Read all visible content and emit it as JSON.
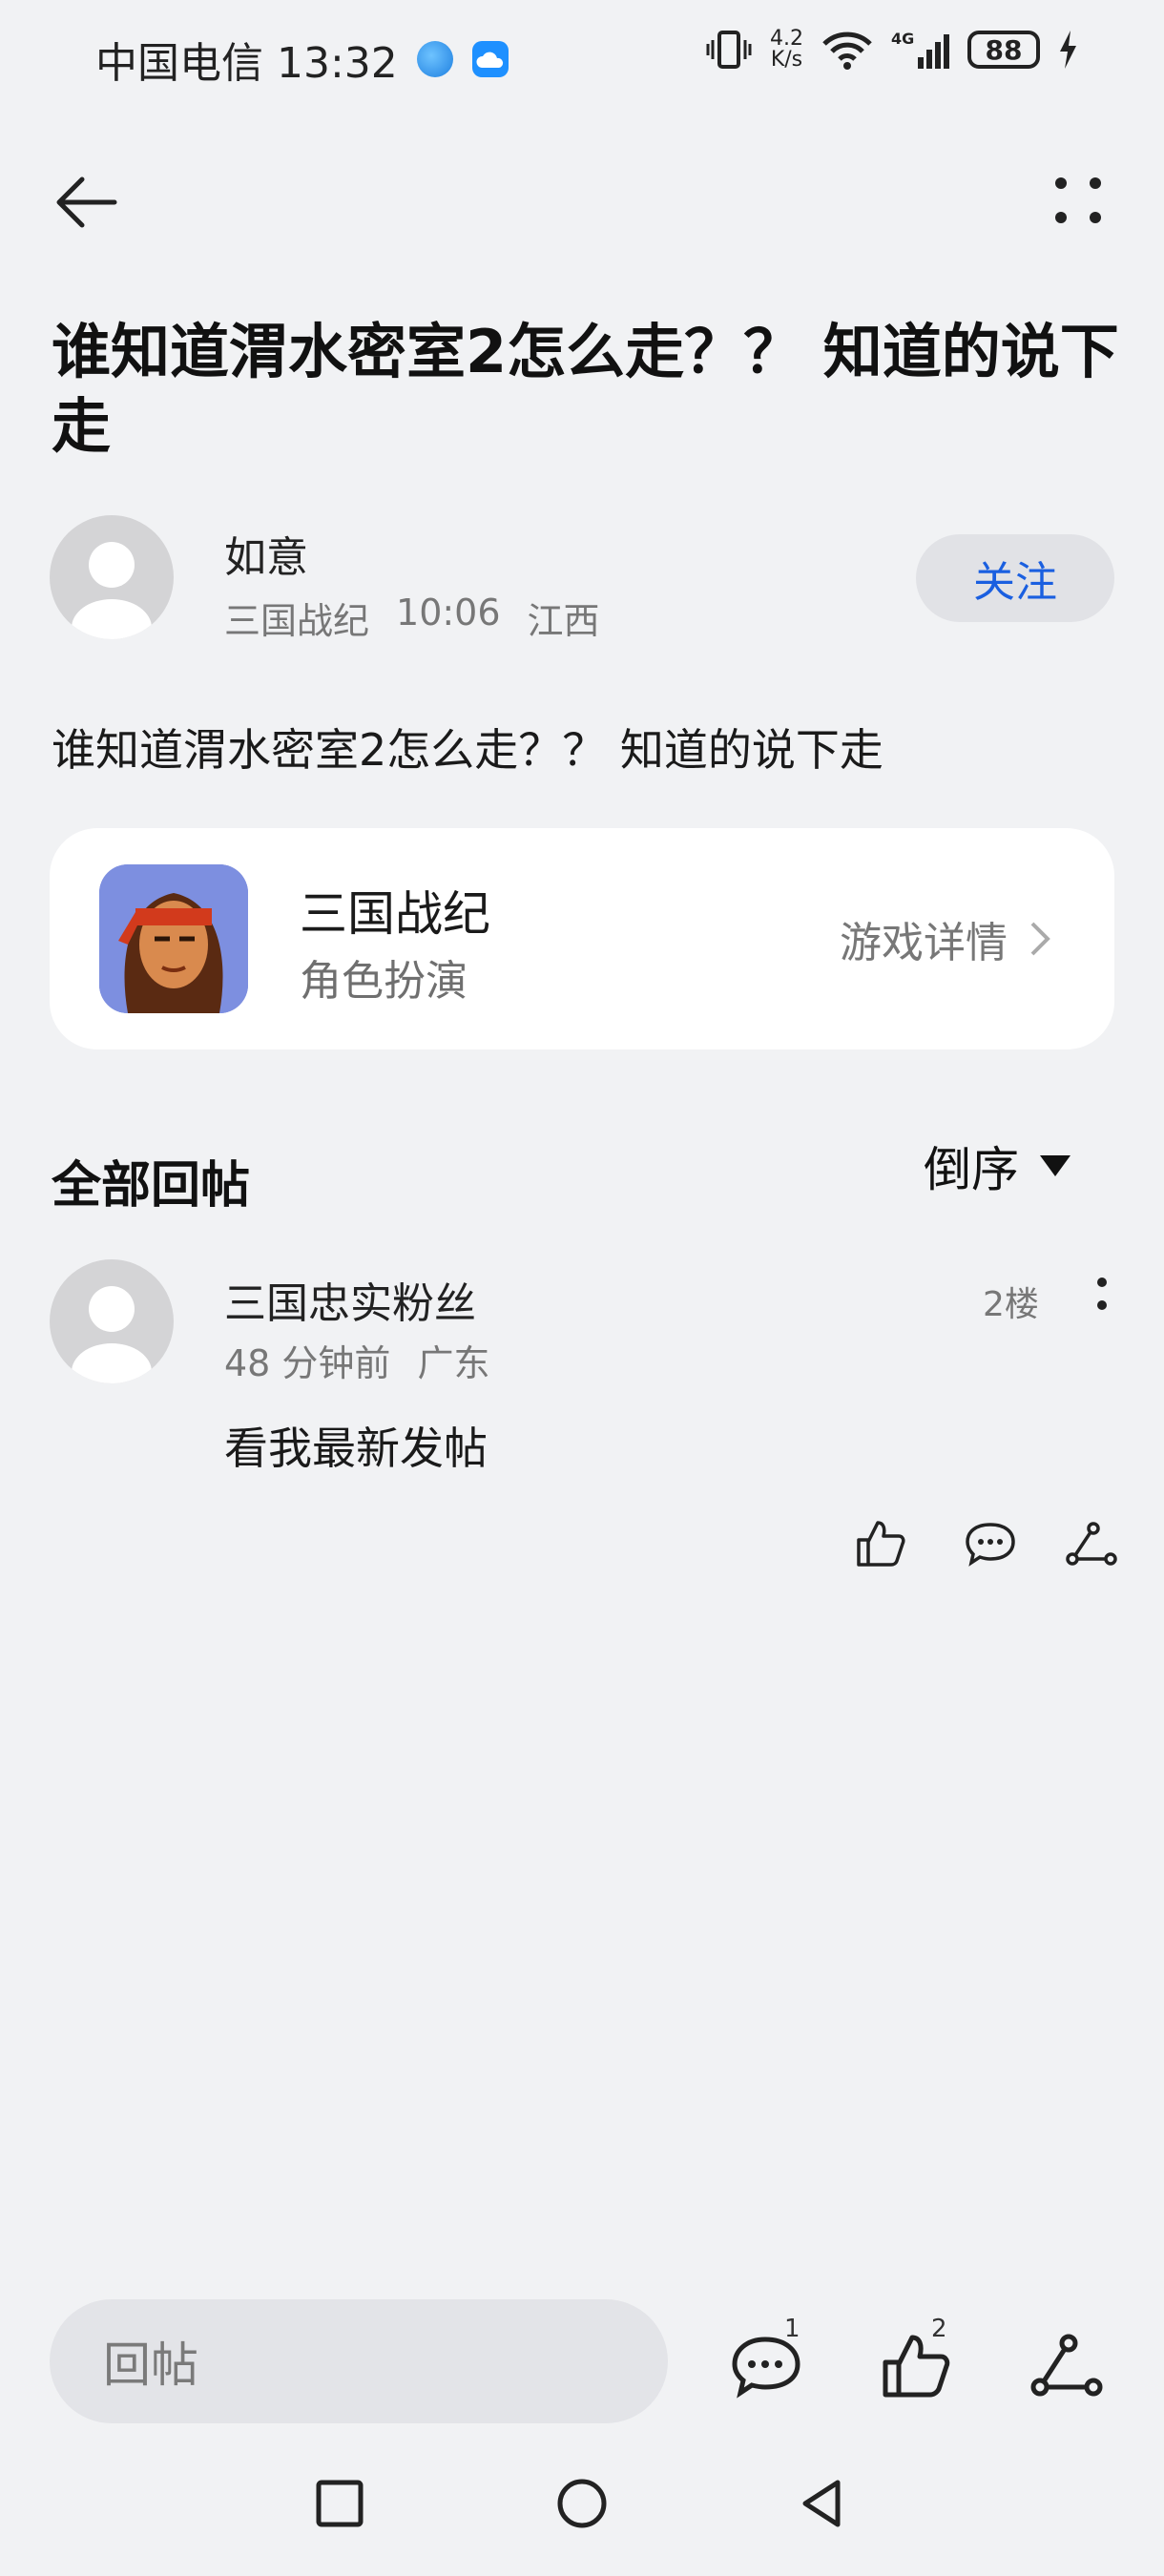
{
  "status_bar": {
    "carrier_time": "中国电信 13:32",
    "net_speed_value": "4.2",
    "net_speed_unit": "K/s",
    "network": "4G",
    "battery": "88"
  },
  "post": {
    "title": "谁知道渭水密室2怎么走？？ 知道的说下走",
    "author": "如意",
    "game_tag": "三国战纪",
    "time": "10:06",
    "location": "江西",
    "follow_label": "关注",
    "body": "谁知道渭水密室2怎么走？？ 知道的说下走"
  },
  "game_card": {
    "name": "三国战纪",
    "genre": "角色扮演",
    "detail_label": "游戏详情"
  },
  "replies": {
    "header": "全部回帖",
    "sort_label": "倒序",
    "items": [
      {
        "name": "三国忠实粉丝",
        "time": "48 分钟前",
        "location": "广东",
        "floor": "2楼",
        "content": "看我最新发帖"
      }
    ]
  },
  "bottom_bar": {
    "reply_placeholder": "回帖",
    "comment_count": "1",
    "like_count": "2"
  },
  "icons": {
    "back": "back-arrow-icon",
    "more": "more-dots-icon",
    "like": "thumbs-up-icon",
    "comment": "comment-icon",
    "share": "share-icon",
    "sort": "caret-down-icon"
  },
  "colors": {
    "background": "#f1f2f4",
    "accent": "#1a5fe0",
    "card": "#ffffff"
  }
}
